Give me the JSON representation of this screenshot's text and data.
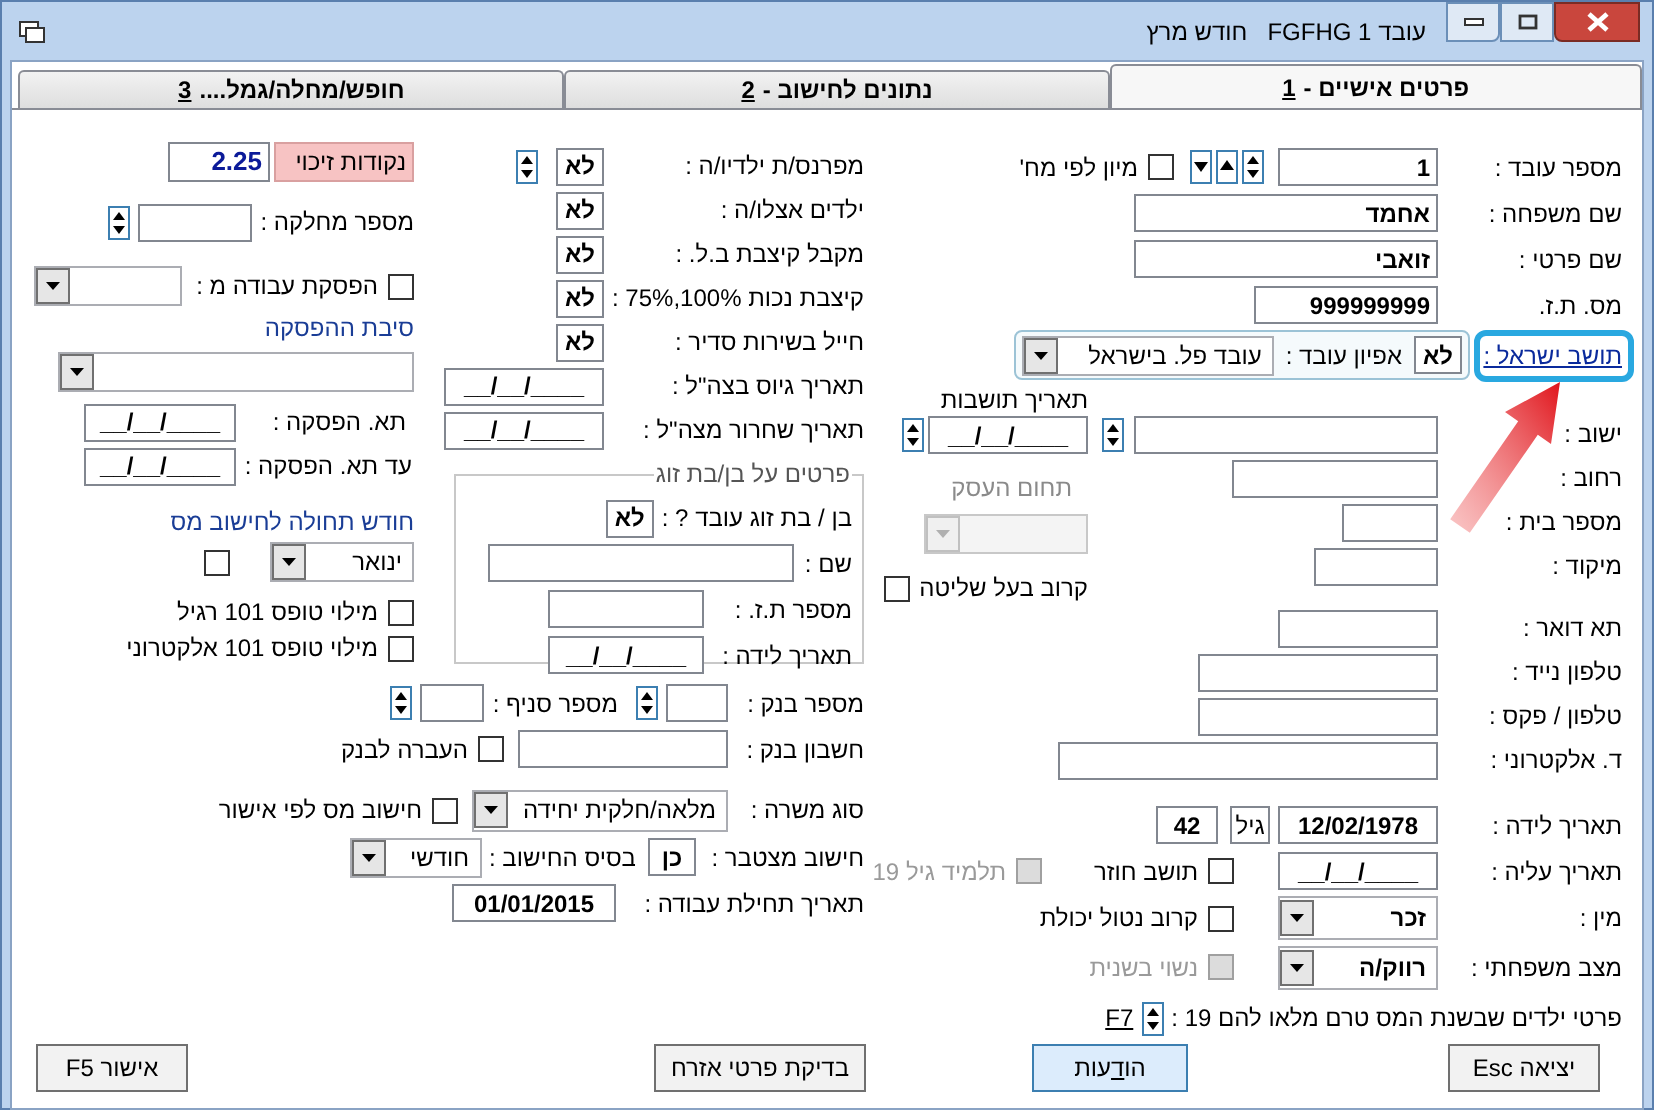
{
  "window": {
    "title": "עובד 1 FGFHG",
    "month": "חודש מרץ"
  },
  "tabs": [
    {
      "label": "פרטים אישיים -",
      "hotkey": "1",
      "selected": true
    },
    {
      "label": "נתונים לחישוב -",
      "hotkey": "2",
      "selected": false
    },
    {
      "label": "חופש/מחלה/גמל....",
      "hotkey": "3",
      "selected": false
    }
  ],
  "employee": {
    "employee_number": {
      "label": "מספר עובד :",
      "value": "1"
    },
    "sort_by_department": {
      "label": "מיון לפי מח'",
      "checked": false
    },
    "last_name": {
      "label": "שם משפחה :",
      "value": "אחמד"
    },
    "first_name": {
      "label": "שם פרטי :",
      "value": "זואבי"
    },
    "id_number": {
      "label": "מס. ת.ז.",
      "value": "999999999"
    },
    "israeli_resident": {
      "label": "תושב ישראל :",
      "value": "לא"
    },
    "employee_type": {
      "label": "אפיון עובד :",
      "value": "עובד פל. בישראל"
    },
    "residency_date": {
      "label": "תאריך תושבות",
      "value": "__/__/____"
    },
    "city": {
      "label": "ישוב :"
    },
    "street": {
      "label": "רחוב :"
    },
    "house_number": {
      "label": "מספר בית :"
    },
    "zip": {
      "label": "מיקוד :"
    },
    "po_box": {
      "label": "תא דואר :"
    },
    "mobile": {
      "label": "טלפון נייד :"
    },
    "phone_fax": {
      "label": "טלפון / פקס :"
    },
    "email": {
      "label": "ד. אלקטרוני :"
    },
    "business_field": {
      "label": "תחום העסק",
      "disabled": true
    },
    "controlling_relative": {
      "label": "קרוב בעל שליטה",
      "checked": false,
      "disabled": false
    },
    "birth_date": {
      "label": "תאריך לידה :",
      "value": "12/02/1978",
      "age_label": "גיל",
      "age": "42"
    },
    "immigration_date": {
      "label": "תאריך עליה :",
      "value": "__/__/____"
    },
    "returning_resident": {
      "label": "תושב חוזר",
      "checked": false,
      "disabled": false
    },
    "student_19": {
      "label": "תלמיד גיל 19",
      "checked": false,
      "disabled": true
    },
    "gender": {
      "label": "מין :",
      "value": "זכר"
    },
    "disabled_relative": {
      "label": "קרוב נטול יכולת",
      "checked": false,
      "disabled": false
    },
    "marital_status": {
      "label": "מצב משפחתי :",
      "value": "רווק/ה"
    },
    "remarried": {
      "label": "נשוי בשנית",
      "checked": false,
      "disabled": true
    },
    "children_under_19": {
      "label": "פרטי ילדים שבשנת המס טרם מלאו להם 19 :",
      "hotkey": "F7"
    }
  },
  "family": {
    "provider": {
      "label": "מפרנס/ת ילדיו/ה :",
      "value": "לא"
    },
    "children_with": {
      "label": "ילדים אצלו/ה :",
      "value": "לא"
    },
    "nii_allowance": {
      "label": "מקבל קיצבת  ב.ל. :",
      "value": "לא"
    },
    "disability_allowance": {
      "label": "קיצבת נכות 100%,75% :",
      "value": "לא"
    },
    "soldier": {
      "label": "חייל בשירות סדיר :",
      "value": "לא"
    },
    "enlistment_date": {
      "label": "תאריך גיוס בצה\"ל :",
      "value": "__/__/____"
    },
    "discharge_date": {
      "label": "תאריך שחרור מצה\"ל :",
      "value": "__/__/____"
    }
  },
  "spouse": {
    "title": "פרטים על בן/בת זוג",
    "works": {
      "label": "בן / בת זוג עובד ? :",
      "value": "לא"
    },
    "name": {
      "label": "שם :"
    },
    "id_number": {
      "label": "מספר ת.ז. :"
    },
    "birth_date": {
      "label": "תאריך לידה :",
      "value": "__/__/____"
    }
  },
  "credit": {
    "credit_points": {
      "label": "נקודות זיכוי",
      "value": "2.25"
    },
    "department": {
      "label": "מספר מחלקה :"
    },
    "stop_work": {
      "label": "הפסקת עבודה מ :",
      "checked": false
    },
    "stop_reason": {
      "label": "סיבת ההפסקה"
    },
    "stop_date": {
      "label": "תא. הפסקה :",
      "value": "__/__/____"
    },
    "stop_until": {
      "label": "עד תא. הפסקה :",
      "value": "__/__/____"
    },
    "tax_month": {
      "label": "חודש תחולה לחישוב מס",
      "value": "ינואר",
      "checked": false
    },
    "form101_regular": {
      "label": "מילוי טופס 101 רגיל",
      "checked": false
    },
    "form101_electronic": {
      "label": "מילוי טופס 101 אלקטרוני",
      "checked": false
    }
  },
  "employment": {
    "bank": {
      "label": "מספר בנק :"
    },
    "branch": {
      "label": "מספר סניף :"
    },
    "account": {
      "label": "חשבון בנק :"
    },
    "bank_transfer": {
      "label": "העברה לבנק",
      "checked": false
    },
    "job_type": {
      "label": "סוג משרה :",
      "value": "מלאה/חלקית יחידה"
    },
    "tax_by_approval": {
      "label": "חישוב מס לפי אישור",
      "checked": false
    },
    "cumulative": {
      "label": "חישוב מצטבר :",
      "value": "כן"
    },
    "calc_basis": {
      "label": "בסיס החישוב :",
      "value": "חודשי"
    },
    "start_date": {
      "label": "תאריך תחילת עבודה :",
      "value": "01/01/2015"
    }
  },
  "buttons": [
    {
      "label": "יציאה Esc",
      "default": false
    },
    {
      "label": "הו",
      "hotkey": "ד",
      "rest": "עות",
      "default": true
    },
    {
      "label": "בדיקת פרטי אזרח",
      "default": false
    },
    {
      "label": "אישור F5",
      "default": false
    }
  ]
}
